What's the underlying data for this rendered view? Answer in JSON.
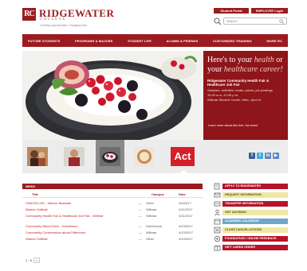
{
  "header": {
    "logo_mark": "RC",
    "logo_name": "RIDGEWATER",
    "logo_sub": "COLLEGE",
    "logo_tagline": "Creating opportunities. Changing lives.",
    "student_portal_label": "Student Portal",
    "employee_login_label": "EMPLOYEE Login",
    "search_placeholder": "Search..."
  },
  "nav": {
    "items": [
      "FUTURE STUDENTS",
      "PROGRAMS & MAJORS",
      "STUDENT LIFE",
      "ALUMNI & FRIENDS",
      "CUSTOMIZED TRAINING",
      "MORE RC"
    ]
  },
  "hero": {
    "headline_part1": "Here's to your ",
    "headline_em1": "health",
    "headline_part2": " or your ",
    "headline_em2": "healthcare career!",
    "event_title": "Ridgewater Community Health Fair & Healthcare Job Fair",
    "event_desc1": "Samples, activities, treats, prizes, job postings",
    "event_desc2": "10:30 a.m.-12:30 p.m.",
    "event_desc3": "Willmar Student Center, Wed., April 11",
    "more_link": "Learn more about this free, fun event"
  },
  "thumbnails": {
    "act_label": "Act",
    "social_icons": [
      "facebook-icon",
      "twitter-icon",
      "linkedin-icon",
      "youtube-icon"
    ]
  },
  "news": {
    "tab_label": "NEWS",
    "columns": {
      "title": "Title",
      "author": "Campus",
      "date": "Date"
    },
    "rows": [
      {
        "title": "CANCELLED - Warrior Baseball",
        "author": "Other",
        "date": "4/9/2017"
      },
      {
        "title": "Warrior Softball",
        "author": "Willmar",
        "date": "4/11/2017"
      },
      {
        "title": "Community Health Fair & Healthcare Job Fair - Willmar",
        "author": "Willmar",
        "date": "4/11/2017"
      },
      {
        "title": "Community Blood Drive - Hutchinson",
        "author": "Hutchinson",
        "date": "4/13/2017"
      },
      {
        "title": "Community Conversation about Difference",
        "author": "Willmar",
        "date": "4/13/2017"
      },
      {
        "title": "Warrior Softball",
        "author": "Other",
        "date": "4/14/2017"
      }
    ],
    "row_dash": "—",
    "pager_current": "1 - 6",
    "pager_next": "»"
  },
  "quick_links": [
    {
      "label": "APPLY TO RIDGEWATER",
      "style": "red",
      "icon": "apply-icon"
    },
    {
      "label": "REQUEST INFORMATION",
      "style": "yellow",
      "icon": "info-icon"
    },
    {
      "label": "TRANSFER INFORMATION",
      "style": "red",
      "icon": "transfer-icon"
    },
    {
      "label": "GET ADVISING",
      "style": "yellow",
      "icon": "advising-icon"
    },
    {
      "label": "ACADEMIC CALENDAR",
      "style": "blue",
      "icon": "calendar-icon"
    },
    {
      "label": "CLASS CANCELLATIONS",
      "style": "yellow",
      "icon": "cancel-icon"
    },
    {
      "label": "FOUNDATION / ONLINE FEEDBACK",
      "style": "red",
      "icon": "feedback-icon"
    },
    {
      "label": "GIFT CARDS ORDER",
      "style": "red",
      "icon": "gift-icon"
    }
  ],
  "colors": {
    "brand": "#9b1b1f",
    "link": "#c31a21",
    "yellow": "#efe8a4",
    "blue": "#6fa7c8"
  }
}
